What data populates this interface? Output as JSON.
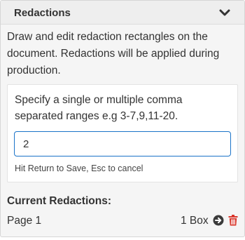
{
  "panel": {
    "title": "Redactions",
    "collapse_icon": "chevron-down-icon",
    "description": "Draw and edit redaction rectangles on the document. Redactions will be applied during production."
  },
  "range_form": {
    "instructions": "Specify a single or multiple comma separated ranges e.g 3-7,9,11-20.",
    "input_value": "2",
    "hint": "Hit Return to Save, Esc to cancel"
  },
  "current_redactions": {
    "heading": "Current Redactions:",
    "items": [
      {
        "page_label": "Page 1",
        "box_count": "1 Box",
        "goto_icon": "arrow-circle-right-icon",
        "delete_icon": "trash-icon"
      }
    ]
  },
  "colors": {
    "input_border": "#1a73c8",
    "trash": "#d9362b",
    "goto_icon": "#3a3a3a"
  }
}
